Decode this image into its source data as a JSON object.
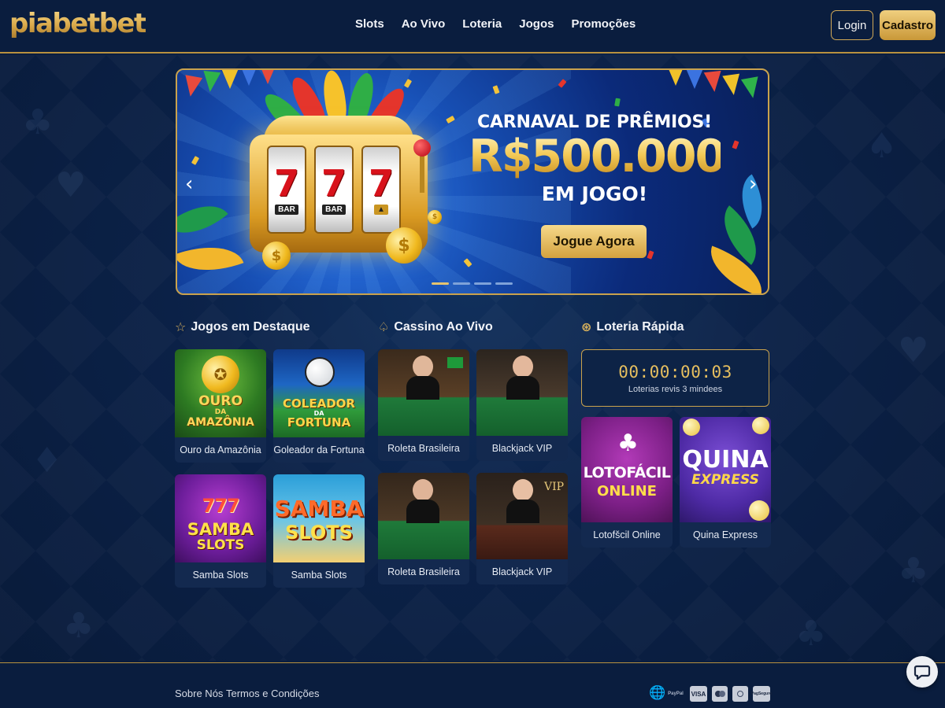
{
  "brand": {
    "logo_text": "piabetbet"
  },
  "nav": [
    {
      "label": "Slots"
    },
    {
      "label": "Ao Vivo"
    },
    {
      "label": "Loteria"
    },
    {
      "label": "Jogos"
    },
    {
      "label": "Promoções"
    }
  ],
  "auth": {
    "login_label": "Login",
    "signup_label": "Cadastro"
  },
  "banner": {
    "title": "CARNAVAL DE PRÊMIOS!",
    "amount": "R$500.000",
    "subtitle": "EM JOGO!",
    "cta": "Jogue Agora",
    "slides_total": 4,
    "active_slide": 1
  },
  "sections": {
    "featured": {
      "title": "Jogos em Destaque",
      "icon": "star-icon",
      "games": [
        {
          "label": "Ouro da Amazônia",
          "art_line1": "OURO",
          "art_line2": "DA",
          "art_line3": "AMAZÔNIA"
        },
        {
          "label": "Goleador da Fortuna",
          "art_line1": "COLEADOR",
          "art_line2": "DA",
          "art_line3": "FORTUNA"
        },
        {
          "label": "Samba Slots",
          "art_line1": "SAMBA",
          "art_line2": "SLOTS",
          "art_line3": "777"
        },
        {
          "label": "Samba Slots",
          "art_line1": "SAMBA",
          "art_line2": "SLOTS"
        }
      ]
    },
    "live": {
      "title": "Cassino Ao Vivo",
      "icon": "spade-icon",
      "games": [
        {
          "label": "Roleta Brasileira"
        },
        {
          "label": "Blackjack VIP"
        },
        {
          "label": "Roleta Brasileira"
        },
        {
          "label": "Blackjack VIP",
          "art_tag": "VIP"
        }
      ]
    },
    "lottery": {
      "title": "Loteria Rápida",
      "icon": "lottery-ball-icon",
      "timer": {
        "value": "00:00:00:03",
        "caption": "Loterias revis 3 mindees"
      },
      "games": [
        {
          "label": "Lotofšcil Online",
          "art_line1": "LOTOFÁCIL",
          "art_line2": "ONLINE"
        },
        {
          "label": "Quina Express",
          "art_line1": "QUINA",
          "art_line2": "EXPRESS"
        }
      ]
    }
  },
  "footer": {
    "links": [
      {
        "label": "Sobre Nós"
      },
      {
        "label": "Termos e Condições"
      }
    ],
    "payments": [
      {
        "label": "PayPal"
      },
      {
        "label": "VISA"
      },
      {
        "label": "Mastercard"
      },
      {
        "label": "Pix"
      },
      {
        "label": "PagSeguro"
      }
    ]
  },
  "colors": {
    "background": "#0b2147",
    "header": "#0a1d3e",
    "gold": "#d2a957",
    "card": "#13294f"
  }
}
